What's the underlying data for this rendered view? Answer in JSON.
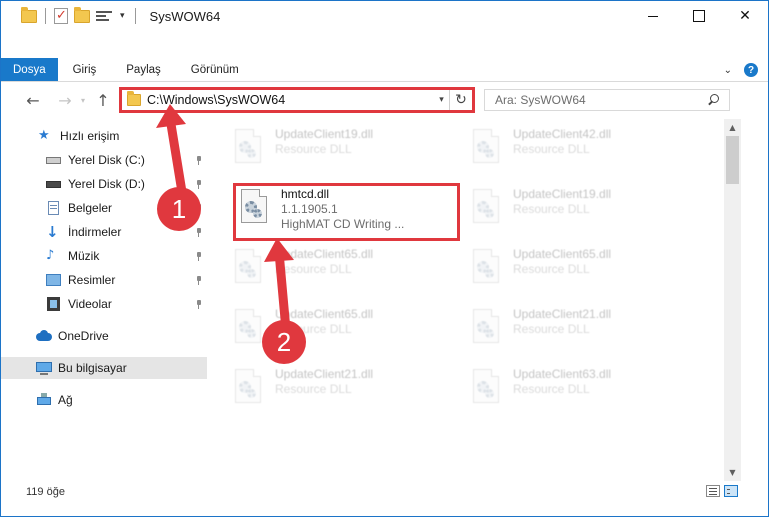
{
  "window": {
    "title": "SysWOW64"
  },
  "ribbon": {
    "tabs": [
      "Dosya",
      "Giriş",
      "Paylaş",
      "Görünüm"
    ]
  },
  "address": {
    "path": "C:\\Windows\\SysWOW64"
  },
  "search": {
    "placeholder": "Ara: SysWOW64"
  },
  "sidebar": {
    "items": [
      {
        "label": "Hızlı erişim",
        "icon": "star-icon"
      },
      {
        "label": "Yerel Disk (C:)",
        "icon": "drive-icon",
        "pinned": true
      },
      {
        "label": "Yerel Disk (D:)",
        "icon": "drive-icon",
        "pinned": true
      },
      {
        "label": "Belgeler",
        "icon": "documents-icon",
        "pinned": true
      },
      {
        "label": "İndirmeler",
        "icon": "download-icon",
        "pinned": true
      },
      {
        "label": "Müzik",
        "icon": "music-icon",
        "pinned": true
      },
      {
        "label": "Resimler",
        "icon": "pictures-icon",
        "pinned": true
      },
      {
        "label": "Videolar",
        "icon": "videos-icon",
        "pinned": true
      },
      {
        "label": "OneDrive",
        "icon": "cloud-icon"
      },
      {
        "label": "Bu bilgisayar",
        "icon": "computer-icon",
        "selected": true
      },
      {
        "label": "Ağ",
        "icon": "network-icon"
      }
    ]
  },
  "files": {
    "left": [
      {
        "name": "UpdateClient19.dll",
        "sub": "Resource DLL"
      },
      {
        "name": "hmtcd.dll",
        "version": "1.1.1905.1",
        "sub": "HighMAT CD Writing ..."
      },
      {
        "name": "UpdateClient65.dll",
        "sub": "Resource DLL"
      },
      {
        "name": "UpdateClient65.dll",
        "sub": "Resource DLL"
      },
      {
        "name": "UpdateClient21.dll",
        "sub": "Resource DLL"
      }
    ],
    "right": [
      {
        "name": "UpdateClient42.dll",
        "sub": "Resource DLL"
      },
      {
        "name": "UpdateClient19.dll",
        "sub": "Resource DLL"
      },
      {
        "name": "UpdateClient65.dll",
        "sub": "Resource DLL"
      },
      {
        "name": "UpdateClient21.dll",
        "sub": "Resource DLL"
      },
      {
        "name": "UpdateClient63.dll",
        "sub": "Resource DLL"
      }
    ]
  },
  "status": {
    "count": "119 öğe"
  },
  "annotations": {
    "step1": "1",
    "step2": "2",
    "color": "#e0383e"
  }
}
